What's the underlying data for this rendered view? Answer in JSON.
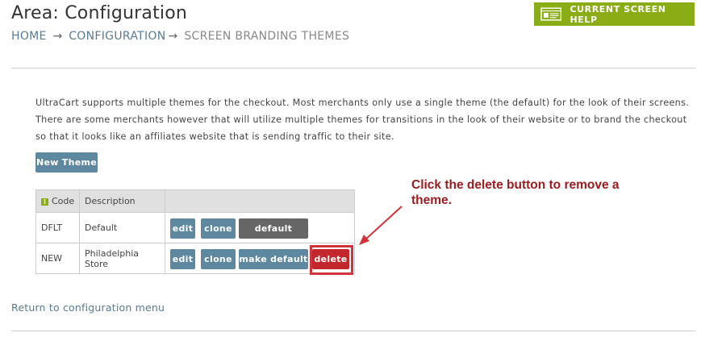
{
  "header": {
    "title": "Area: Configuration",
    "breadcrumb": {
      "home": "HOME",
      "configuration": "CONFIGURATION",
      "current": "SCREEN BRANDING THEMES",
      "separator": "→"
    },
    "help_button": {
      "label": "CURRENT SCREEN HELP",
      "icon": "screen-help-icon",
      "color": "#8aac14"
    }
  },
  "intro_text": "UltraCart supports multiple themes for the checkout. Most merchants only use a single theme (the default) for the look of their screens. There are some merchants however that will utilize multiple themes for transitions in the look of their website or to brand the checkout so that it looks like an affiliates website that is sending traffic to their site.",
  "new_theme_button": {
    "label": "New Theme"
  },
  "table": {
    "headers": {
      "info_icon": "i",
      "code": "Code",
      "description": "Description",
      "actions": ""
    },
    "rows": [
      {
        "code": "DFLT",
        "description": "Default",
        "actions": {
          "edit": "edit",
          "clone": "clone",
          "default": "default"
        }
      },
      {
        "code": "NEW",
        "description": "Philadelphia Store",
        "actions": {
          "edit": "edit",
          "clone": "clone",
          "make_default": "make default",
          "delete": "delete"
        }
      }
    ]
  },
  "annotation": {
    "text": "Click the delete button to remove a theme.",
    "color": "#9b1b1f"
  },
  "footer": {
    "return_link": "Return to configuration menu"
  },
  "colors": {
    "blue_button": "#5d88a0",
    "gray_button": "#666666",
    "red_button": "#c1272d",
    "link": "#5b7b91"
  }
}
